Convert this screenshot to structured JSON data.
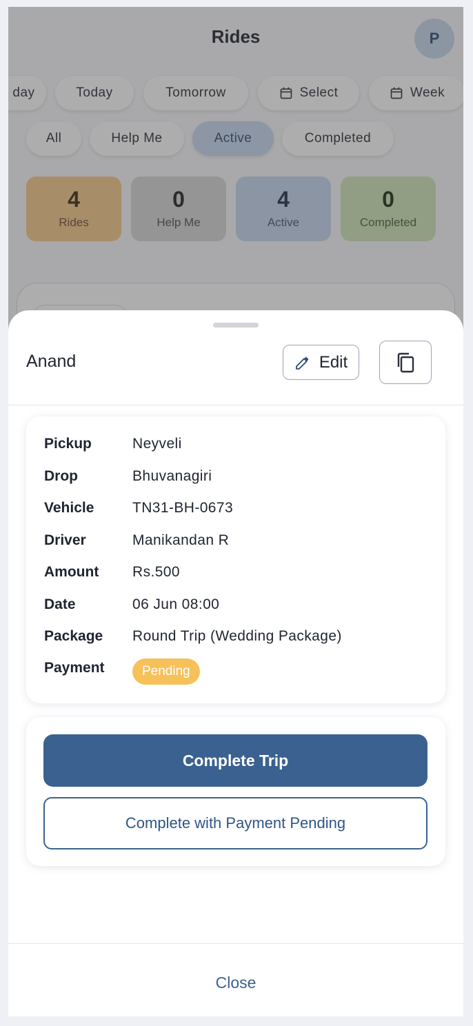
{
  "header": {
    "title": "Rides",
    "avatar_initial": "P"
  },
  "date_filters": [
    {
      "label": "day",
      "icon": ""
    },
    {
      "label": "Today",
      "icon": ""
    },
    {
      "label": "Tomorrow",
      "icon": ""
    },
    {
      "label": "Select",
      "icon": "calendar-icon"
    },
    {
      "label": "Week",
      "icon": "calendar-icon"
    }
  ],
  "status_filters": [
    {
      "label": "All",
      "active": false
    },
    {
      "label": "Help Me",
      "active": false
    },
    {
      "label": "Active",
      "active": true
    },
    {
      "label": "Completed",
      "active": false
    }
  ],
  "stats": [
    {
      "value": "4",
      "label": "Rides",
      "color": "#f6c98a",
      "text_color": "#3a2a12"
    },
    {
      "value": "0",
      "label": "Help Me",
      "color": "#d6d6d6",
      "text_color": "#222222"
    },
    {
      "value": "4",
      "label": "Active",
      "color": "#c5d6f0",
      "text_color": "#1c2f4a"
    },
    {
      "value": "0",
      "label": "Completed",
      "color": "#cfe6b8",
      "text_color": "#1f2f12"
    }
  ],
  "sheet": {
    "title": "Anand",
    "edit_label": "Edit",
    "details": {
      "pickup_label": "Pickup",
      "pickup": "Neyveli",
      "drop_label": "Drop",
      "drop": "Bhuvanagiri",
      "vehicle_label": "Vehicle",
      "vehicle": "TN31-BH-0673",
      "driver_label": "Driver",
      "driver": "Manikandan R",
      "amount_label": "Amount",
      "amount": "Rs.500",
      "date_label": "Date",
      "date": "06 Jun 08:00",
      "package_label": "Package",
      "package": "Round Trip (Wedding Package)",
      "payment_label": "Payment",
      "payment_status": "Pending"
    },
    "complete_trip_label": "Complete Trip",
    "complete_pending_label": "Complete with Payment Pending",
    "close_label": "Close"
  },
  "colors": {
    "primary": "#3a6190",
    "pending_badge": "#f7c15a",
    "overlay": "rgba(60,60,60,0.42)"
  }
}
